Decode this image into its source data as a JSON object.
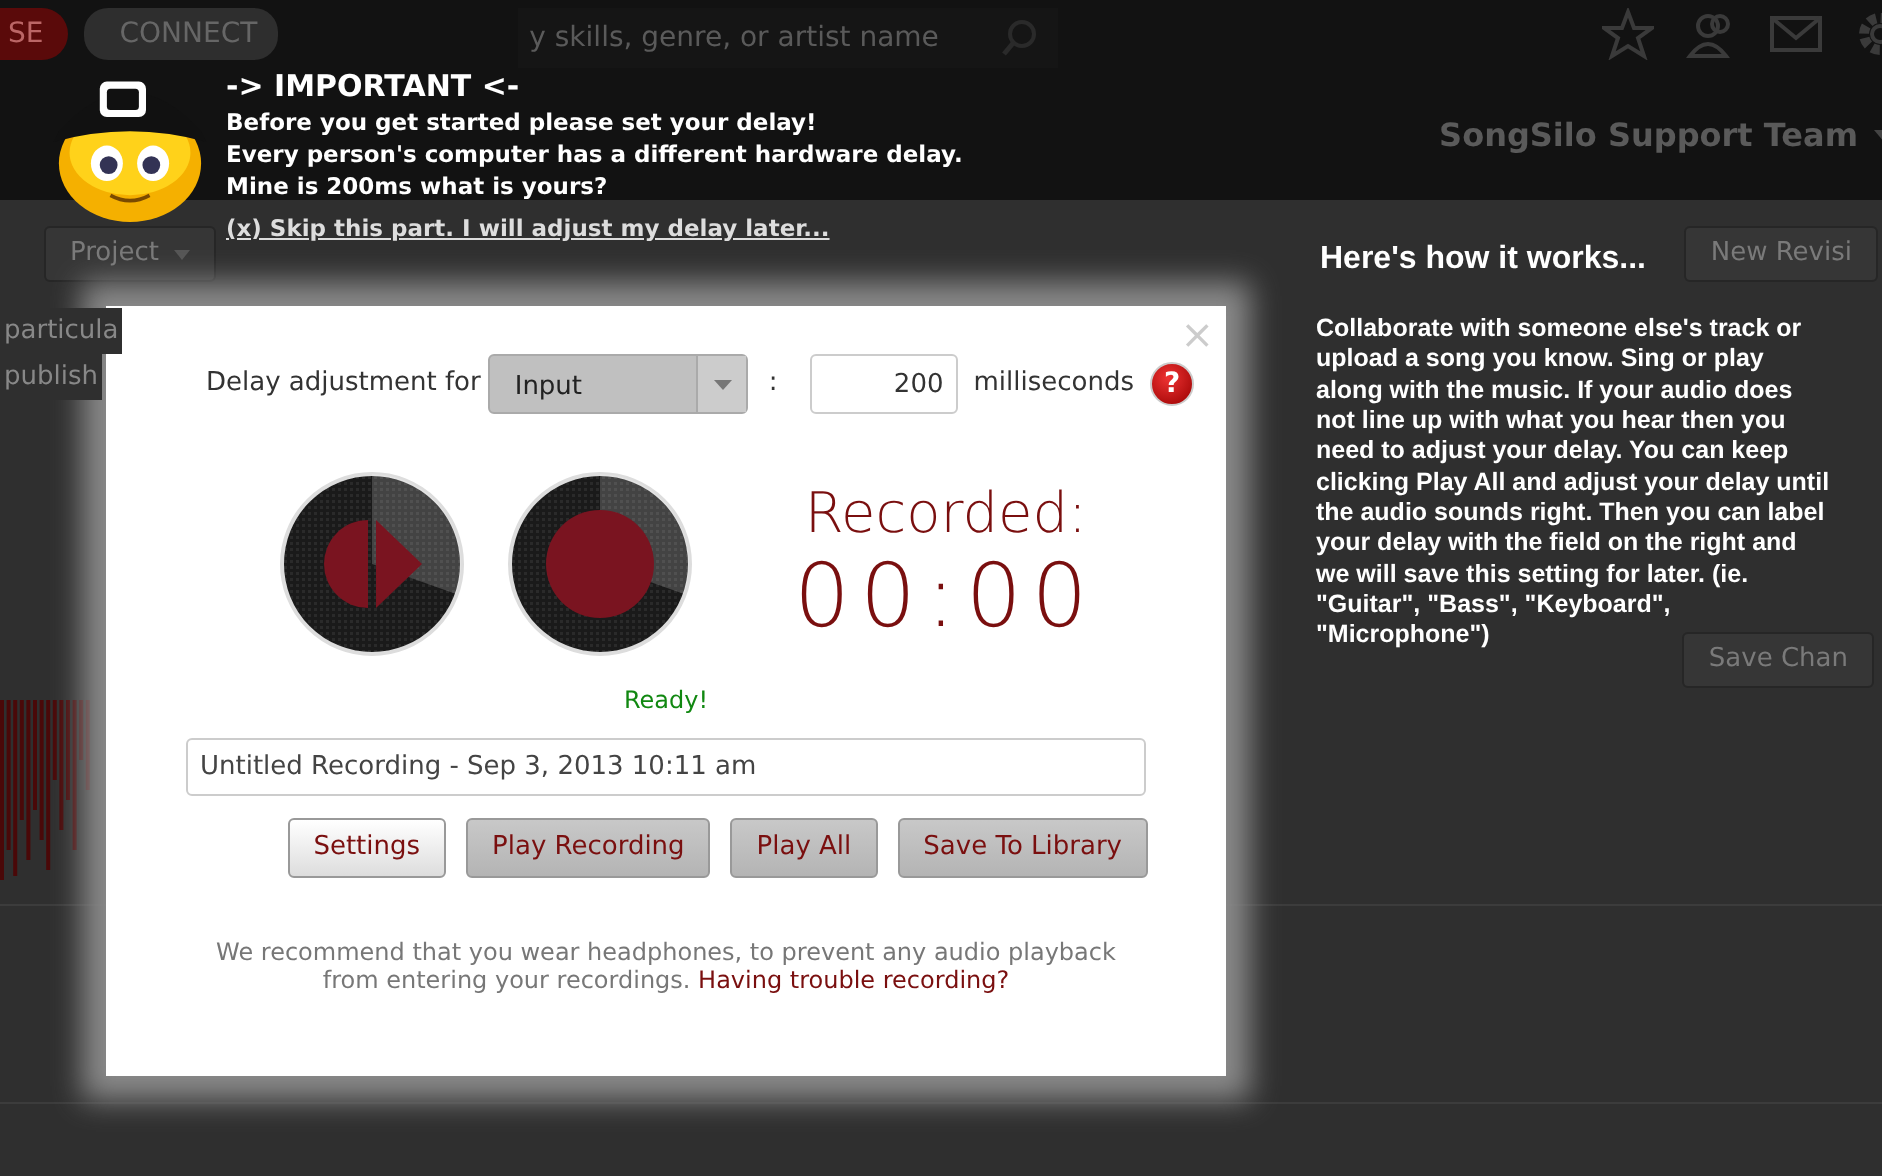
{
  "page": {
    "nav": {
      "left_button": "SE",
      "connect_button": "CONNECT",
      "search_placeholder": "y skills, genre, or artist name",
      "user_menu": "SongSilo Support Team"
    },
    "toolbar": {
      "project_button": "Project",
      "right_button": "New Revisi"
    },
    "side_text": [
      "particula",
      "publish"
    ],
    "row_button": "Save Chan"
  },
  "tips": [
    {
      "kind": "important",
      "title": "-> IMPORTANT <-",
      "lines": [
        "Before you get started please set your delay!",
        "Every person's computer has a different hardware delay.",
        "Mine is 200ms what is yours?"
      ],
      "link": "(x) Skip this part. I will adjust my delay later..."
    },
    {
      "kind": "howto",
      "title": "Here's how it works...",
      "body": "Collaborate with someone else's track or upload a song you know. Sing or play along with the music. If your audio does not line up with what you hear then you need to adjust your delay. You can keep clicking Play All and adjust your delay until the audio sounds right. Then you can label your delay with the field on the right and we will save this setting for later. (ie. \"Guitar\", \"Bass\", \"Keyboard\", \"Microphone\")"
    }
  ],
  "dialog": {
    "close": "×",
    "delay_label": "Delay adjustment for",
    "input_select": "Input",
    "separator": ":",
    "delay_value": "200",
    "unit": "milliseconds",
    "help": "?",
    "recorded_label": "Recorded:",
    "timer": "00:00",
    "status": "Ready!",
    "title_value": "Untitled Recording - Sep 3, 2013 10:11 am",
    "buttons": [
      {
        "label": "Settings",
        "kind": "light"
      },
      {
        "label": "Play Recording",
        "kind": "dark"
      },
      {
        "label": "Play All",
        "kind": "dark"
      },
      {
        "label": "Save To Library",
        "kind": "dark"
      }
    ],
    "note": "We recommend that you wear headphones, to prevent any audio playback from entering your recordings.",
    "note_link": "Having trouble recording?"
  }
}
